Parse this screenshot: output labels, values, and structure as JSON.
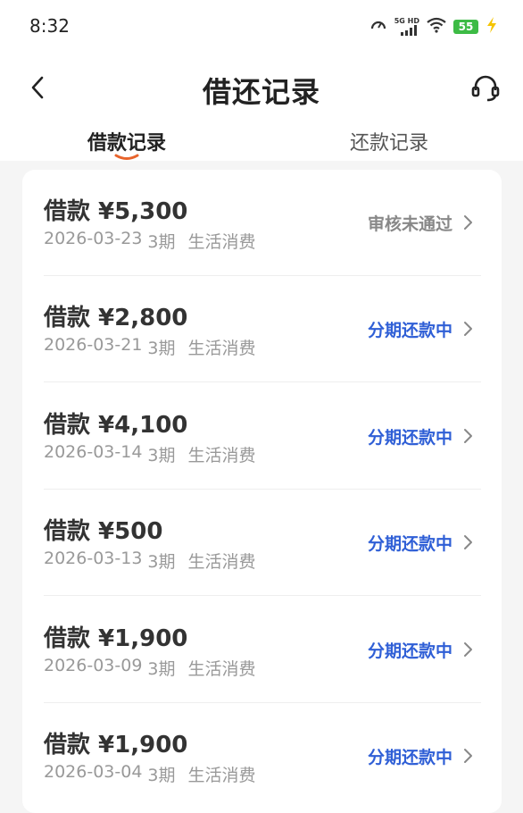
{
  "status_bar": {
    "time": "8:32",
    "network_label": "5G HD",
    "battery": "55",
    "battery_color": "#3dbb45"
  },
  "header": {
    "title": "借还记录",
    "back_icon": "chevron-left-icon",
    "support_icon": "headset-icon"
  },
  "tabs": [
    {
      "label": "借款记录",
      "active": true
    },
    {
      "label": "还款记录",
      "active": false
    }
  ],
  "colors": {
    "accent_underline": "#e8642c",
    "status_in_progress": "#2f5fd6",
    "status_rejected": "#888888"
  },
  "records": [
    {
      "amount": "借款 ¥5,300",
      "date": "2026-03-23",
      "term": "3期",
      "purpose": "生活消费",
      "status": "审核未通过",
      "status_type": "rejected"
    },
    {
      "amount": "借款 ¥2,800",
      "date": "2026-03-21",
      "term": "3期",
      "purpose": "生活消费",
      "status": "分期还款中",
      "status_type": "in_progress"
    },
    {
      "amount": "借款 ¥4,100",
      "date": "2026-03-14",
      "term": "3期",
      "purpose": "生活消费",
      "status": "分期还款中",
      "status_type": "in_progress"
    },
    {
      "amount": "借款 ¥500",
      "date": "2026-03-13",
      "term": "3期",
      "purpose": "生活消费",
      "status": "分期还款中",
      "status_type": "in_progress"
    },
    {
      "amount": "借款 ¥1,900",
      "date": "2026-03-09",
      "term": "3期",
      "purpose": "生活消费",
      "status": "分期还款中",
      "status_type": "in_progress"
    },
    {
      "amount": "借款 ¥1,900",
      "date": "2026-03-04",
      "term": "3期",
      "purpose": "生活消费",
      "status": "分期还款中",
      "status_type": "in_progress"
    }
  ]
}
